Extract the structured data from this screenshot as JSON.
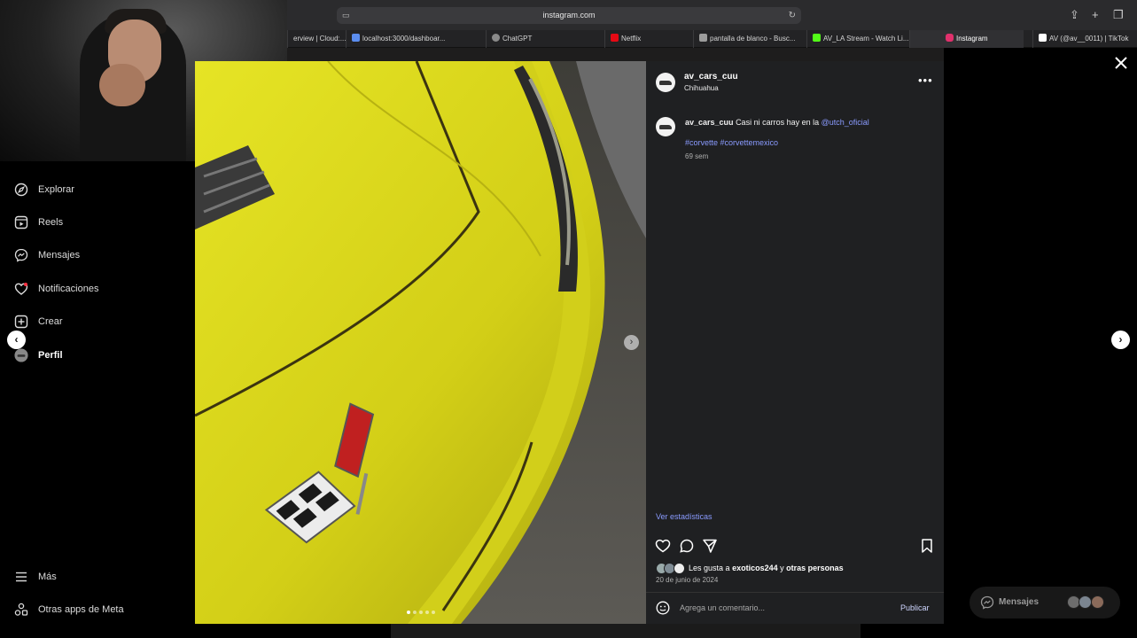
{
  "browser": {
    "url": "instagram.com",
    "tabs": [
      {
        "label": "erview | Cloud:...",
        "color": "#3a6fd8"
      },
      {
        "label": "localhost:3000/dashboar...",
        "color": "#5b8def"
      },
      {
        "label": "ChatGPT",
        "color": "#8a8a8a"
      },
      {
        "label": "Netflix",
        "color": "#e50914"
      },
      {
        "label": "pantalla de blanco - Busc...",
        "color": "#9c9c9c"
      },
      {
        "label": "AV_LA Stream - Watch Li...",
        "color": "#53fc18"
      },
      {
        "label": "Instagram",
        "color": "#e1306c"
      },
      {
        "label": "AV (@av__0011) | TikTok",
        "color": "#ffffff"
      }
    ]
  },
  "sidebar": {
    "items": [
      {
        "label": "Explorar",
        "icon": "compass-icon"
      },
      {
        "label": "Reels",
        "icon": "reels-icon"
      },
      {
        "label": "Mensajes",
        "icon": "messenger-icon"
      },
      {
        "label": "Notificaciones",
        "icon": "heart-icon"
      },
      {
        "label": "Crear",
        "icon": "plus-square-icon"
      },
      {
        "label": "Perfil",
        "icon": "profile-avatar"
      }
    ],
    "bottom": [
      {
        "label": "Más",
        "icon": "menu-icon"
      },
      {
        "label": "Otras apps de Meta",
        "icon": "apps-icon"
      }
    ]
  },
  "post": {
    "username": "av_cars_cuu",
    "location": "Chihuahua",
    "caption_user": "av_cars_cuu",
    "caption_text": "Casi ni carros hay en la",
    "caption_mention": "@utch_oficial",
    "hashtags": "#corvette #corvettemexico",
    "time_ago": "69 sem",
    "view_stats": "Ver estadísticas",
    "likes_prefix": "Les gusta a",
    "likes_user": "exoticos244",
    "likes_suffix": "y",
    "likes_others": "otras personas",
    "date": "20 de junio de 2024",
    "comment_placeholder": "Agrega un comentario...",
    "publish_label": "Publicar",
    "carousel_count": 5,
    "carousel_active": 1
  },
  "messages_pill": {
    "label": "Mensajes"
  },
  "colors": {
    "accent_link": "#8a9bff",
    "panel_bg": "#1f2022",
    "car_yellow": "#d8d51c"
  }
}
